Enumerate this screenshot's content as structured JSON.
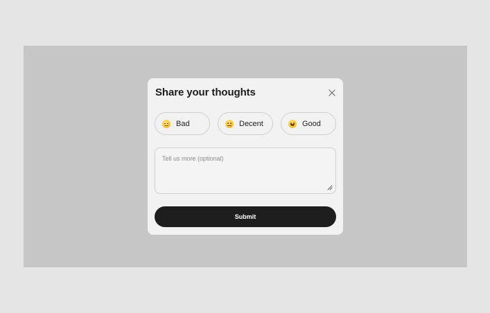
{
  "modal": {
    "title": "Share your thoughts",
    "close_icon": "close-icon"
  },
  "ratings": [
    {
      "label": "Bad",
      "icon": "unamused-face-icon"
    },
    {
      "label": "Decent",
      "icon": "neutral-face-icon"
    },
    {
      "label": "Good",
      "icon": "grinning-face-icon"
    }
  ],
  "comment": {
    "placeholder": "Tell us more (optional)",
    "value": ""
  },
  "submit": {
    "label": "Submit"
  },
  "colors": {
    "page_background": "#e5e5e5",
    "backdrop": "#c6c6c6",
    "modal_background": "#f2f2f2",
    "submit_background": "#1e1e1e",
    "text_primary": "#1c1c1c"
  }
}
